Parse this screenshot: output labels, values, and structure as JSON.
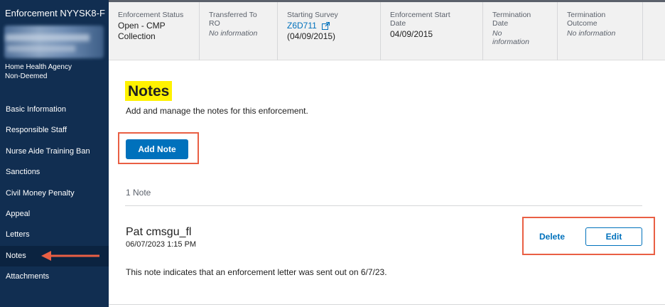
{
  "sidebar": {
    "title": "Enforcement NYYSK8-F",
    "facility_type": "Home Health Agency",
    "deemed_status": "Non-Deemed",
    "items": [
      {
        "label": "Basic Information"
      },
      {
        "label": "Responsible Staff"
      },
      {
        "label": "Nurse Aide Training Ban"
      },
      {
        "label": "Sanctions"
      },
      {
        "label": "Civil Money Penalty"
      },
      {
        "label": "Appeal"
      },
      {
        "label": "Letters"
      },
      {
        "label": "Notes",
        "active": true
      },
      {
        "label": "Attachments"
      }
    ]
  },
  "header": {
    "enforcement_status": {
      "label": "Enforcement Status",
      "value_line1": "Open - CMP",
      "value_line2": "Collection"
    },
    "transferred_to": {
      "label_line1": "Transferred To",
      "label_line2": "RO",
      "value": "No information"
    },
    "starting_survey": {
      "label": "Starting Survey",
      "link": "Z6D711",
      "date": "(04/09/2015)"
    },
    "enforcement_start": {
      "label_line1": "Enforcement Start",
      "label_line2": "Date",
      "value": "04/09/2015"
    },
    "termination_date": {
      "label_line1": "Termination",
      "label_line2": "Date",
      "value_line1": "No",
      "value_line2": "information"
    },
    "termination_outcome": {
      "label_line1": "Termination",
      "label_line2": "Outcome",
      "value": "No information"
    }
  },
  "main": {
    "title": "Notes",
    "description": "Add and manage the notes for this enforcement.",
    "add_button": "Add Note",
    "count": "1 Note",
    "note": {
      "author": "Pat cmsgu_fl",
      "timestamp": "06/07/2023 1:15 PM",
      "text": "This note indicates that an enforcement letter was sent out on 6/7/23.",
      "delete_label": "Delete",
      "edit_label": "Edit"
    }
  },
  "colors": {
    "sidebar_bg": "#112e51",
    "primary": "#0071bc",
    "highlight": "#fff200",
    "annotation": "#e95f44"
  },
  "icons": {
    "external_link": "external-link-icon",
    "annotation_arrow": "arrow-left-icon"
  }
}
